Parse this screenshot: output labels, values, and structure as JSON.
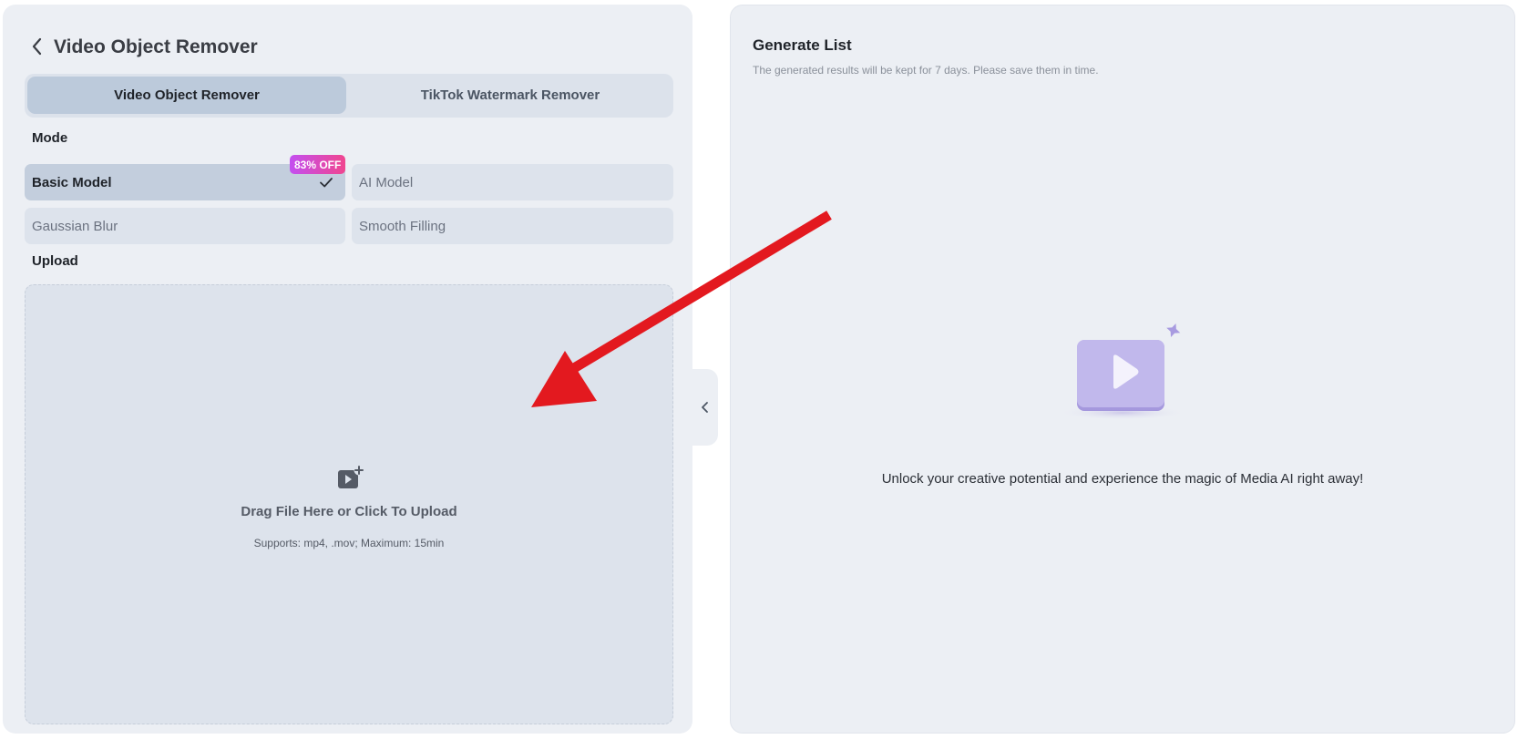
{
  "header": {
    "title": "Video Object Remover"
  },
  "tabs": [
    {
      "label": "Video Object Remover",
      "active": true
    },
    {
      "label": "TikTok Watermark Remover",
      "active": false
    }
  ],
  "mode": {
    "label": "Mode",
    "badge": "83% OFF",
    "options": [
      {
        "label": "Basic Model",
        "selected": true
      },
      {
        "label": "AI Model",
        "selected": false
      },
      {
        "label": "Gaussian Blur",
        "selected": false
      },
      {
        "label": "Smooth Filling",
        "selected": false
      }
    ]
  },
  "upload": {
    "label": "Upload",
    "title": "Drag File Here or Click To Upload",
    "supports": "Supports: mp4, .mov; Maximum: 15min"
  },
  "generate_list": {
    "title": "Generate List",
    "subtitle": "The generated results will be kept for 7 days. Please save them in time.",
    "empty_message": "Unlock your creative potential and experience the magic of Media AI right away!"
  },
  "colors": {
    "accent_badge_start": "#c34ff0",
    "accent_badge_end": "#f0468f",
    "annotation_arrow": "#e3191f",
    "illustration": "#a89be0"
  },
  "icons": {
    "back": "chevron-left-icon",
    "check": "checkmark-icon",
    "upload": "video-plus-icon",
    "collapse": "chevron-left-icon",
    "empty_state": "play-video-illustration"
  }
}
